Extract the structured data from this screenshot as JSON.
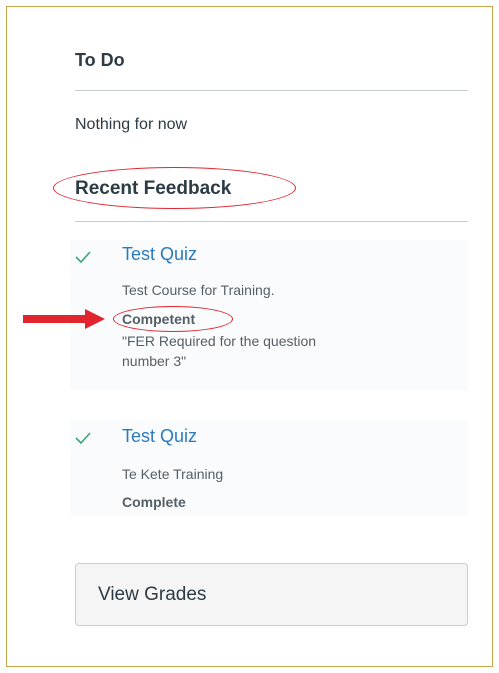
{
  "todo": {
    "title": "To Do",
    "empty_text": "Nothing for now"
  },
  "recent_feedback": {
    "title": "Recent Feedback",
    "items": [
      {
        "status_icon": "checkmark-icon",
        "title": "Test Quiz",
        "course": "Test Course for Training.",
        "grade": "Competent",
        "comment_line1": "\"FER Required for the question",
        "comment_line2": "number 3\""
      },
      {
        "status_icon": "checkmark-icon",
        "title": "Test Quiz",
        "course": "Te Kete Training",
        "grade": "Complete"
      }
    ]
  },
  "view_grades": {
    "label": "View Grades"
  },
  "colors": {
    "link": "#2b7abc",
    "check": "#3aa776",
    "annotation": "#e0252f",
    "frame": "#c9a64a"
  }
}
